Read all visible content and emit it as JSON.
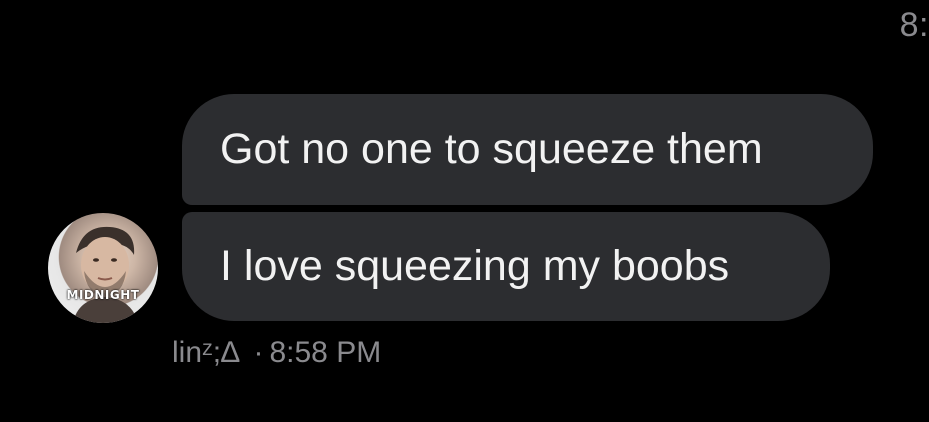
{
  "header": {
    "corner_time": "8:"
  },
  "messages": [
    {
      "text": "Got no one to squeeze them"
    },
    {
      "text": "I love squeezing my boobs"
    }
  ],
  "sender": {
    "avatar_text": "MIDNIGHT",
    "name": "linᶻ;∆",
    "separator": "·",
    "time": "8:58 PM"
  },
  "colors": {
    "background": "#000000",
    "bubble": "#2c2d30",
    "bubble_text": "#f2f2f2",
    "meta_text": "#8a8a8e"
  }
}
